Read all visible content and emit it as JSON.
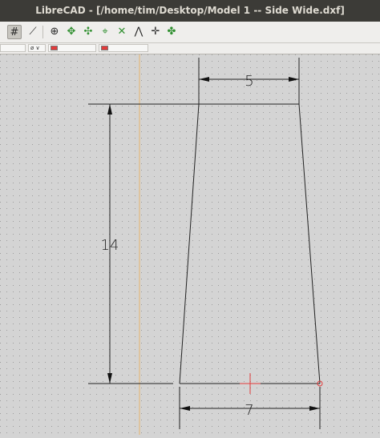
{
  "window": {
    "title": "LibreCAD - [/home/tim/Desktop/Model 1 -- Side Wide.dxf]"
  },
  "toolbar": {
    "tools": [
      {
        "name": "grid-toggle-icon",
        "glyph": "#",
        "active": true
      },
      {
        "name": "snap-free-icon",
        "glyph": "⟋"
      },
      {
        "name": "snap-grid-icon",
        "glyph": "⊕"
      },
      {
        "name": "snap-endpoint-icon",
        "glyph": "✥",
        "green": true
      },
      {
        "name": "snap-on-entity-icon",
        "glyph": "✣",
        "green": true
      },
      {
        "name": "snap-center-icon",
        "glyph": "⌖",
        "green": true
      },
      {
        "name": "snap-middle-icon",
        "glyph": "✕",
        "green": true
      },
      {
        "name": "snap-distance-icon",
        "glyph": "⋀"
      },
      {
        "name": "snap-intersection-icon",
        "glyph": "✛"
      },
      {
        "name": "restrict-icon",
        "glyph": "✤",
        "green": true
      }
    ]
  },
  "penbar": {
    "line_width": "ø ∨",
    "color_1": "▬",
    "color_2": "▬"
  },
  "dimensions": {
    "top_width": "5",
    "height": "14",
    "bottom_width": "7"
  },
  "colors": {
    "canvas_bg": "#d4d4d4",
    "grid_dot": "#a0a0a0",
    "line": "#222222",
    "cursor": "#e23b3b",
    "ucs_axis": "#e9b56c"
  }
}
